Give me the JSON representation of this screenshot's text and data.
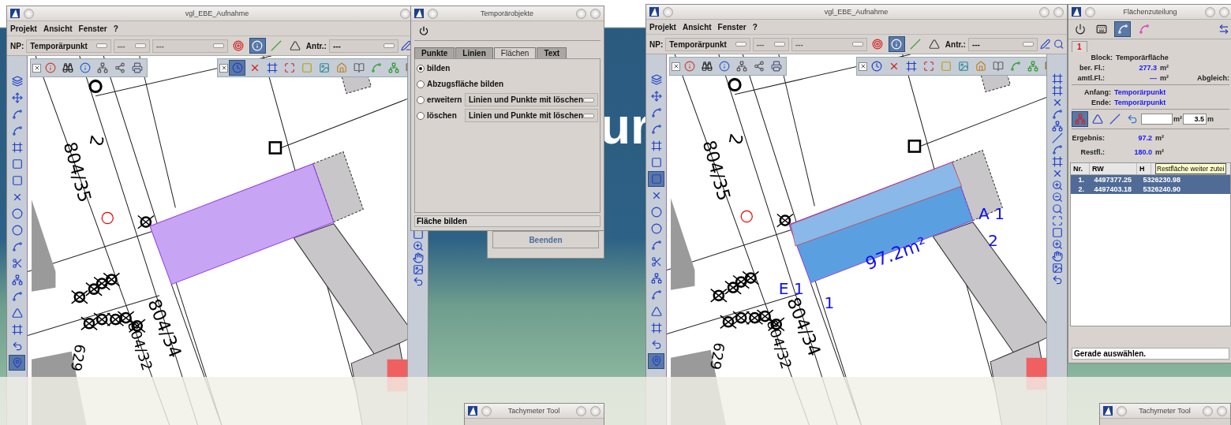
{
  "slide_fragment": "ur",
  "screens": [
    {
      "main_window": {
        "title": "vgl_EBE_Aufnahme",
        "menu": [
          "Projekt",
          "Ansicht",
          "Fenster",
          "?"
        ],
        "np_label": "NP:",
        "np_value": "Temporärpunkt",
        "combo_2": "---",
        "combo_3": "---",
        "antr_label": "Antr.:",
        "antr_value": "---",
        "toolbar": [
          {
            "selected": false
          },
          {
            "selected": true
          },
          {
            "selected": false
          },
          {
            "selected": false
          }
        ],
        "float_toolbar_1": [
          {
            "selected": false
          },
          {
            "selected": false
          },
          {
            "selected": false
          },
          {
            "selected": false
          },
          {
            "selected": false
          },
          {
            "selected": false
          }
        ],
        "float_toolbar_2": [
          {
            "selected": true
          },
          {
            "selected": false
          },
          {
            "selected": false
          },
          {
            "selected": false
          },
          {
            "selected": false
          },
          {
            "selected": false
          },
          {
            "selected": false
          },
          {
            "selected": false
          },
          {
            "selected": false
          },
          {
            "selected": false
          },
          {
            "selected": false
          }
        ],
        "side_toolbar": [
          {
            "selected": false
          },
          {
            "selected": false
          },
          {
            "selected": false
          },
          {
            "selected": false
          },
          {
            "selected": false
          },
          {
            "selected": false
          },
          {
            "selected": false
          },
          {
            "selected": false
          },
          {
            "selected": false
          },
          {
            "selected": false
          },
          {
            "selected": false
          },
          {
            "selected": false
          },
          {
            "selected": false
          },
          {
            "selected": false
          },
          {
            "selected": false
          },
          {
            "selected": false
          },
          {
            "selected": false
          },
          {
            "selected": true
          }
        ],
        "map": {
          "area_divided": false,
          "labels": [
            "2",
            "804/35",
            "804/34",
            "804/32",
            "629"
          ]
        }
      },
      "dialog": {
        "title": "Temporärobjekte",
        "tabs": [
          {
            "label": "Punkte",
            "selected": false
          },
          {
            "label": "Linien",
            "selected": false
          },
          {
            "label": "Flächen",
            "selected": true
          },
          {
            "label": "Text",
            "selected": false
          }
        ],
        "options": [
          {
            "label": "bilden",
            "selected": true
          },
          {
            "label": "Abzugsfläche bilden",
            "selected": false
          },
          {
            "label": "erweitern",
            "selected": false,
            "value": "Linien und Punkte mit löschen"
          },
          {
            "label": "löschen",
            "selected": false,
            "value": "Linien und Punkte mit löschen"
          }
        ],
        "status": "Fläche bilden"
      },
      "behind_button": "Beenden",
      "tachymeter_title": "Tachymeter Tool"
    },
    {
      "main_window": {
        "title": "vgl_EBE_Aufnahme",
        "menu": [
          "Projekt",
          "Ansicht",
          "Fenster",
          "?"
        ],
        "np_label": "NP:",
        "np_value": "Temporärpunkt",
        "combo_2": "---",
        "combo_3": "---",
        "antr_label": "Antr.:",
        "antr_value": "---",
        "toolbar": [
          {
            "selected": false
          },
          {
            "selected": true
          },
          {
            "selected": false
          },
          {
            "selected": false
          }
        ],
        "float_toolbar_1": [
          {
            "selected": false
          },
          {
            "selected": false
          },
          {
            "selected": false
          },
          {
            "selected": false
          },
          {
            "selected": false
          },
          {
            "selected": false
          }
        ],
        "float_toolbar_2": [
          {
            "selected": false
          },
          {
            "selected": false
          },
          {
            "selected": false
          },
          {
            "selected": false
          },
          {
            "selected": false
          },
          {
            "selected": false
          },
          {
            "selected": false
          },
          {
            "selected": false
          },
          {
            "selected": false
          },
          {
            "selected": false
          },
          {
            "selected": false
          }
        ],
        "side_toolbar": [
          {
            "selected": false
          },
          {
            "selected": false
          },
          {
            "selected": false
          },
          {
            "selected": false
          },
          {
            "selected": false
          },
          {
            "selected": false
          },
          {
            "selected": true
          },
          {
            "selected": false
          },
          {
            "selected": false
          },
          {
            "selected": false
          },
          {
            "selected": false
          },
          {
            "selected": false
          },
          {
            "selected": false
          },
          {
            "selected": false
          },
          {
            "selected": false
          },
          {
            "selected": false
          },
          {
            "selected": false
          },
          {
            "selected": true
          }
        ],
        "map": {
          "area_divided": true,
          "labels": [
            "2",
            "804/35",
            "804/34",
            "804/32",
            "629",
            "97.2m²",
            "A 1",
            "2",
            "E 1",
            "1"
          ]
        }
      },
      "panel": {
        "title": "Flächenzuteilung",
        "tools": [
          {
            "selected": false
          },
          {
            "selected": false
          },
          {
            "selected": true
          },
          {
            "selected": false
          }
        ],
        "tab": "1",
        "block_label": "Block:",
        "block_value": "Temporärfläche",
        "ber_label": "ber. Fl.:",
        "ber_value": "277.3",
        "ber_unit": "m²",
        "amtl_label": "amtl.Fl.:",
        "amtl_value": "---",
        "amtl_unit": "m²",
        "abgleich_label": "Abgleich:",
        "anfang_label": "Anfang:",
        "anfang_value": "Temporärpunkt",
        "ende_label": "Ende:",
        "ende_value": "Temporärpunkt",
        "mode_tools": [
          {
            "selected": true
          },
          {
            "selected": false
          },
          {
            "selected": false
          },
          {
            "selected": false
          }
        ],
        "area_unit": "m²",
        "length_value": "3.5",
        "length_unit": "m",
        "ergebnis_label": "Ergebnis:",
        "ergebnis_value": "97.2",
        "ergebnis_unit": "m²",
        "rest_label": "Restfl.:",
        "rest_value": "180.0",
        "rest_unit": "m²",
        "columns": [
          "Nr.",
          "RW",
          "H"
        ],
        "rows": [
          {
            "cells": [
              "1.",
              "4497377.25",
              "5326230.98"
            ],
            "selected": true
          },
          {
            "cells": [
              "2.",
              "4497403.18",
              "5326240.90"
            ],
            "selected": true
          }
        ],
        "tooltip": "Restfläche weiter zutei",
        "status": "Gerade auswählen."
      },
      "tachymeter_title": "Tachymeter Tool"
    }
  ]
}
